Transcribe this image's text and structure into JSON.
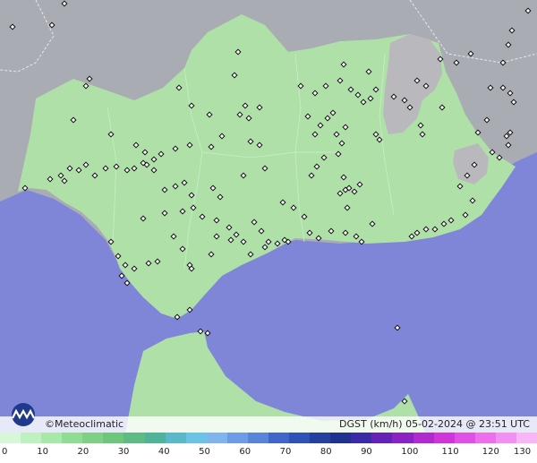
{
  "map": {
    "sea_color": "#7f86d8",
    "land_color": "#aee0a8",
    "outside_color": "#a9acb3",
    "highland_color": "#b9b9bd",
    "station_marker": "diamond-marker"
  },
  "credit": {
    "logo_icon": "meteoclimatic-logo-icon",
    "text": "©Meteoclimatic"
  },
  "product": {
    "text": "DGST (km/h)   05-02-2024 @ 23:51 UTC"
  },
  "scale": {
    "colors": [
      "#d8f6d8",
      "#bff0bf",
      "#a8e8a8",
      "#8fdc94",
      "#7fd085",
      "#6ec67c",
      "#5cbc83",
      "#4fb39a",
      "#59b8c9",
      "#6cc3e8",
      "#7fb4ef",
      "#6e9be8",
      "#5a84db",
      "#3f66c8",
      "#2f52b8",
      "#2541a0",
      "#1f328f",
      "#3b2aa8",
      "#6622b8",
      "#8a22c4",
      "#b02ad0",
      "#d035dc",
      "#e04fe6",
      "#ec70ee",
      "#f38ff2",
      "#f8b6f6"
    ],
    "labels": [
      "0",
      "10",
      "20",
      "30",
      "40",
      "50",
      "60",
      "70",
      "80",
      "90",
      "100",
      "110",
      "120",
      "130"
    ]
  }
}
